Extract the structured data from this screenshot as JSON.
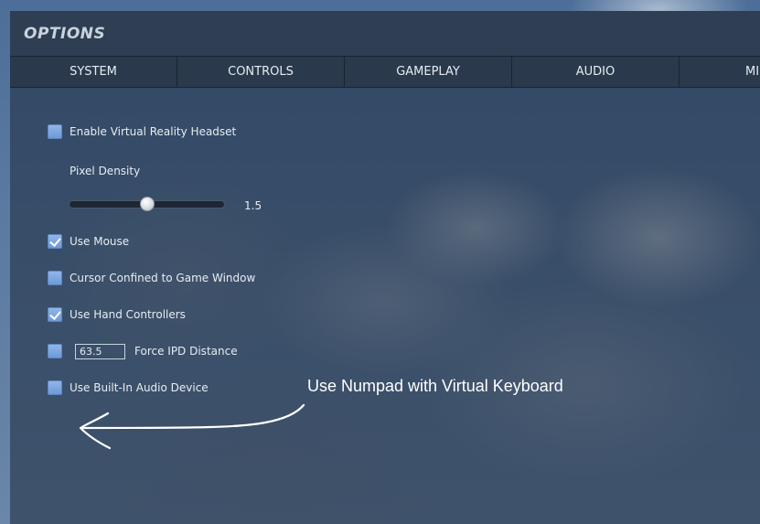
{
  "window": {
    "title": "OPTIONS"
  },
  "tabs": [
    {
      "label": "SYSTEM"
    },
    {
      "label": "CONTROLS"
    },
    {
      "label": "GAMEPLAY"
    },
    {
      "label": "AUDIO"
    },
    {
      "label": "MI"
    }
  ],
  "options": {
    "vr_headset": {
      "label": "Enable Virtual Reality Headset",
      "checked": false
    },
    "pixel_density": {
      "label": "Pixel Density",
      "value": "1.5",
      "fraction": 0.5
    },
    "use_mouse": {
      "label": "Use Mouse",
      "checked": true
    },
    "cursor_confined": {
      "label": "Cursor Confined to Game Window",
      "checked": false
    },
    "hand_controllers": {
      "label": "Use Hand Controllers",
      "checked": true
    },
    "force_ipd": {
      "label": "Force IPD Distance",
      "checked": false,
      "value": "63.5"
    },
    "builtin_audio": {
      "label": "Use Built-In Audio Device",
      "checked": false
    }
  },
  "annotation": {
    "text": "Use Numpad with Virtual Keyboard",
    "color": "#ffffff"
  },
  "colors": {
    "checkbox": "#7aa5de",
    "titlebar": "#2f3e52",
    "tabbar": "#2a394c"
  }
}
